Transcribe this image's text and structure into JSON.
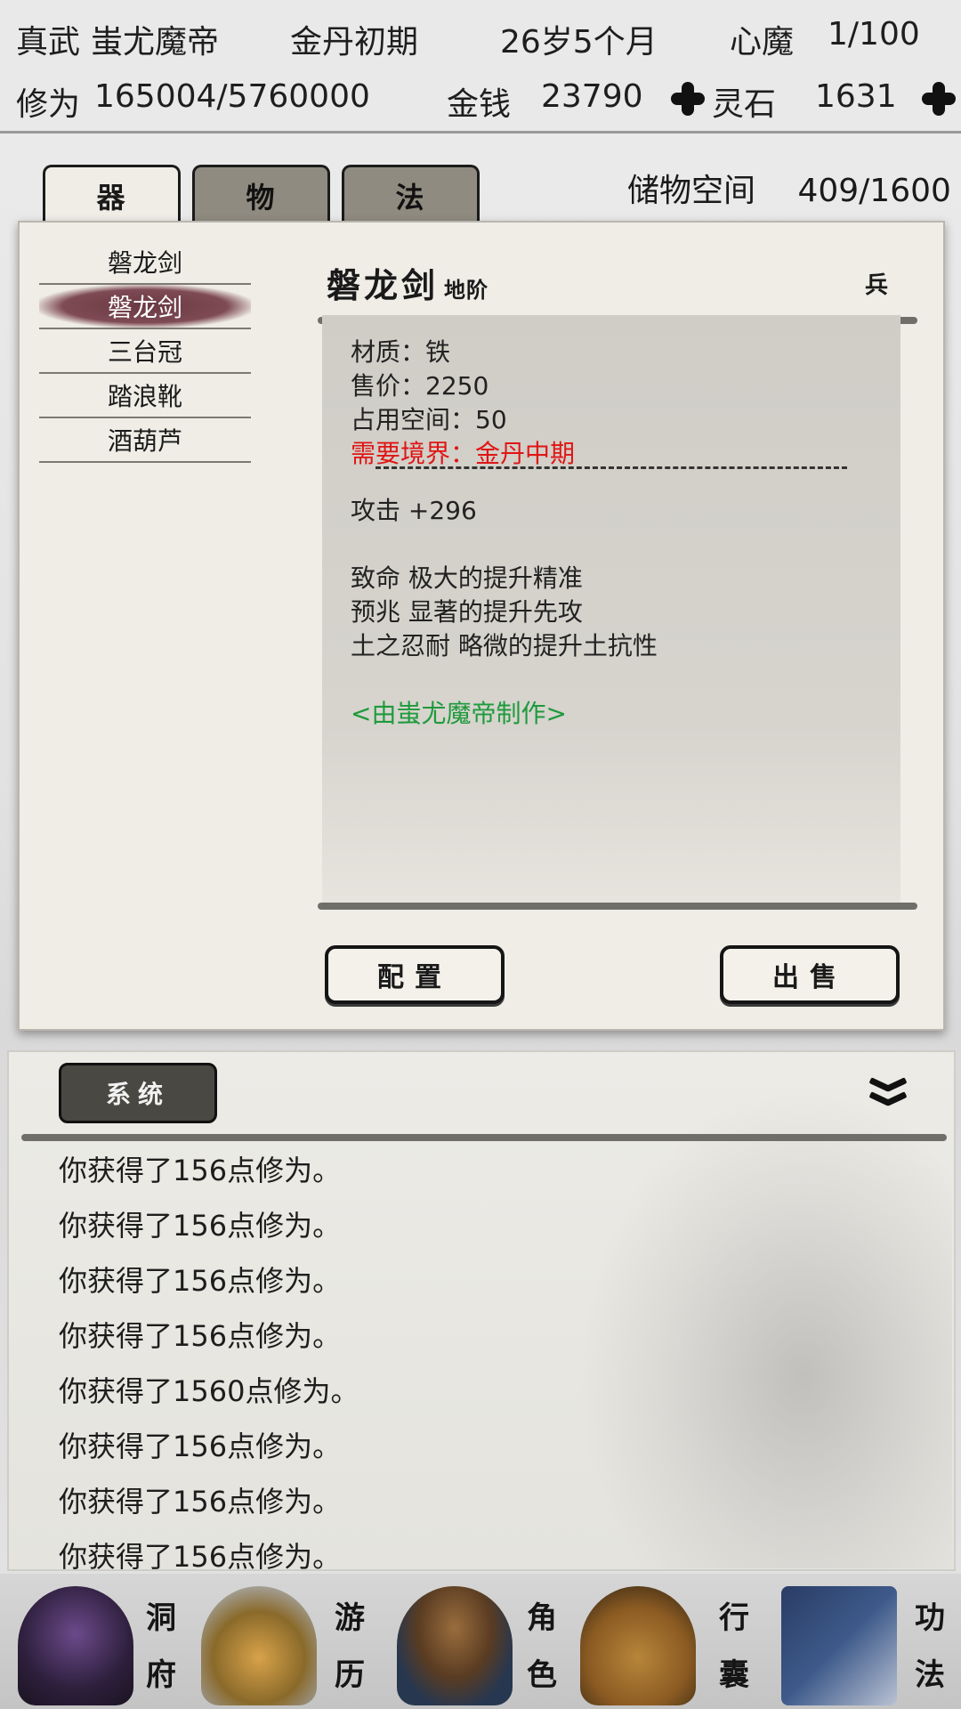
{
  "status": {
    "title": "真武",
    "name": "蚩尤魔帝",
    "realm": "金丹初期",
    "age": "26岁5个月",
    "demon_label": "心魔",
    "demon_value": "1/100",
    "cultivation_label": "修为",
    "cultivation_value": "165004/5760000",
    "money_label": "金钱",
    "money_value": "23790",
    "spirit_stone_label": "灵石",
    "spirit_stone_value": "1631"
  },
  "tabs": [
    {
      "label": "器",
      "active": true
    },
    {
      "label": "物",
      "active": false
    },
    {
      "label": "法",
      "active": false
    }
  ],
  "storage": {
    "label": "储物空间",
    "value": "409/1600"
  },
  "item_list": [
    "磐龙剑",
    "磐龙剑",
    "三台冠",
    "踏浪靴",
    "酒葫芦"
  ],
  "selected_index": 1,
  "item_detail": {
    "name": "磐龙剑",
    "grade": "地阶",
    "type": "兵",
    "material": "材质：铁",
    "price": "售价：2250",
    "space": "占用空间：50",
    "requirement": "需要境界：金丹中期",
    "attack": "攻击 +296",
    "affixes": [
      "致命 极大的提升精准",
      "预兆 显著的提升先攻",
      "土之忍耐 略微的提升土抗性"
    ],
    "maker": "<由蚩尤魔帝制作>"
  },
  "buttons": {
    "equip": "配置",
    "sell": "出售"
  },
  "log": {
    "tab_label": "系统",
    "lines": [
      "你获得了156点修为。",
      "你获得了156点修为。",
      "你获得了156点修为。",
      "你获得了156点修为。",
      "你获得了1560点修为。",
      "你获得了156点修为。",
      "你获得了156点修为。",
      "你获得了156点修为。"
    ]
  },
  "nav": [
    {
      "label": "洞府",
      "icon": "cave-mansion-icon"
    },
    {
      "label": "游历",
      "icon": "travel-grass-icon"
    },
    {
      "label": "角色",
      "icon": "character-hat-icon"
    },
    {
      "label": "行囊",
      "icon": "bag-icon"
    },
    {
      "label": "功法",
      "icon": "scroll-book-icon"
    }
  ],
  "colors": {
    "requirement_red": "#e01515",
    "maker_green": "#1f9a3d",
    "selected_row": "#7e4a53",
    "inactive_tab": "#8f8b80"
  }
}
